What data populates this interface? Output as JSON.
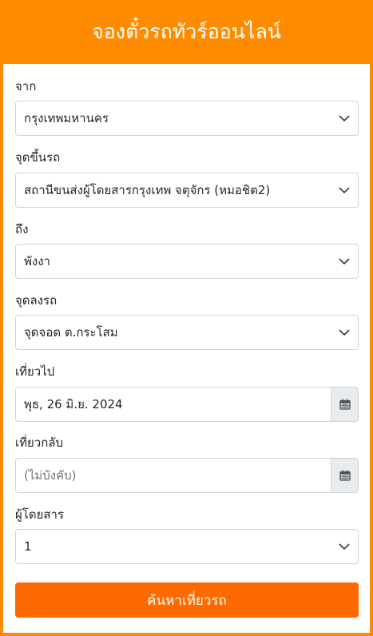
{
  "header": {
    "title": "จองตั๋วรถทัวร์ออนไลน์"
  },
  "form": {
    "origin": {
      "label": "จาก",
      "value": "กรุงเทพมหานคร"
    },
    "boarding": {
      "label": "จุดขึ้นรถ",
      "value": "สถานีขนส่งผู้โดยสารกรุงเทพ จตุจักร (หมอชิต2)"
    },
    "destination": {
      "label": "ถึง",
      "value": "พังงา"
    },
    "dropoff": {
      "label": "จุดลงรถ",
      "value": "จุดจอด ต.กระโสม"
    },
    "depart": {
      "label": "เที่ยวไป",
      "value": "พุธ, 26 มิ.ย. 2024"
    },
    "return": {
      "label": "เที่ยวกลับ",
      "placeholder": "(ไม่บังคับ)"
    },
    "passengers": {
      "label": "ผู้โดยสาร",
      "value": "1"
    },
    "submit_label": "ค้นหาเที่ยวรถ"
  },
  "icons": {
    "select_arrow": "chevron-down-icon",
    "date_picker": "calendar-icon"
  },
  "colors": {
    "brand_orange": "#ff8c00",
    "button_orange": "#ff6a00"
  }
}
